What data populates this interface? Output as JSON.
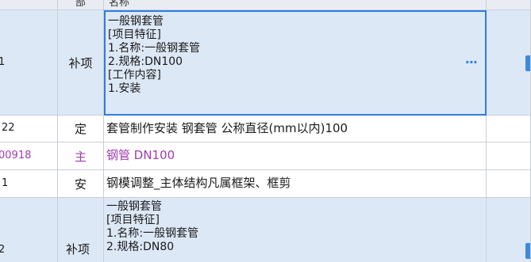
{
  "header": {
    "col_type": "部",
    "col_name": "名称"
  },
  "rows": [
    {
      "code": "1",
      "type": "补项",
      "name_lines": [
        "一般钢套管",
        "[项目特征]",
        "1.名称:一般钢套管",
        "2.规格:DN100",
        "[工作内容]",
        "1.安装"
      ],
      "more_button": "···"
    },
    {
      "code": "22",
      "type": "定",
      "name": "套管制作安装 钢套管 公称直径(mm以内)100"
    },
    {
      "code": "00918",
      "type": "主",
      "name": "钢管 DN100"
    },
    {
      "code": "1",
      "type": "安",
      "name": "钢模调整_主体结构凡属框架、框剪"
    },
    {
      "code": "2",
      "type": "补项",
      "name_lines": [
        "一般钢套管",
        "[项目特征]",
        "1.名称:一般钢套管",
        "2.规格:DN80"
      ]
    }
  ],
  "colors": {
    "selection_border": "#2f7de1",
    "row_blue": "#dde8f6",
    "main_material_text": "#a23bb2"
  }
}
